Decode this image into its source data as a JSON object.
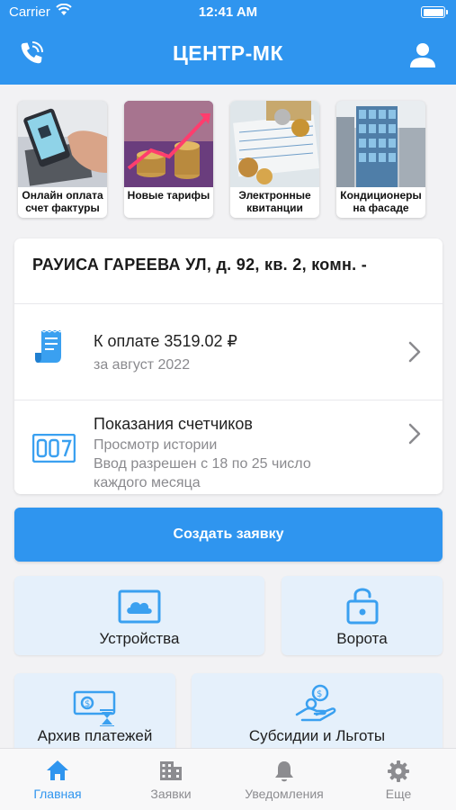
{
  "status_bar": {
    "carrier": "Carrier",
    "time": "12:41 AM"
  },
  "header": {
    "title": "ЦЕНТР-МК",
    "left_icon": "phone-icon",
    "right_icon": "user-icon"
  },
  "news": [
    {
      "caption": "Онлайн оплата счет фактуры"
    },
    {
      "caption": "Новые тарифы"
    },
    {
      "caption": "Электронные квитанции"
    },
    {
      "caption": "Кондиционеры на фасаде"
    }
  ],
  "account": {
    "address": "РАУИСА ГАРЕЕВА УЛ, д. 92, кв. 2, комн. -",
    "payment": {
      "title": "К оплате 3519.02 ₽",
      "subtitle": "за август 2022",
      "icon": "receipt-icon"
    },
    "meters": {
      "title": "Показания счетчиков",
      "line1": "Просмотр истории",
      "line2": "Ввод разрешен с 18 по 25 число",
      "line3": "каждого месяца",
      "icon": "meter-icon"
    }
  },
  "create_request_label": "Создать заявку",
  "tiles": [
    {
      "label": "Устройства",
      "icon": "cloud-icon"
    },
    {
      "label": "Ворота",
      "icon": "lock-icon"
    },
    {
      "label": "Архив платежей",
      "icon": "money-archive-icon"
    },
    {
      "label": "Субсидии и Льготы",
      "icon": "hand-coins-icon"
    }
  ],
  "tabs": [
    {
      "label": "Главная",
      "icon": "home-icon",
      "active": true
    },
    {
      "label": "Заявки",
      "icon": "building-icon",
      "active": false
    },
    {
      "label": "Уведомления",
      "icon": "bell-icon",
      "active": false
    },
    {
      "label": "Еще",
      "icon": "gear-icon",
      "active": false
    }
  ],
  "colors": {
    "primary": "#2f95ef",
    "tile_bg": "#e5f0fb",
    "icon_blue": "#3aa0f0",
    "inactive": "#8c8c90"
  }
}
